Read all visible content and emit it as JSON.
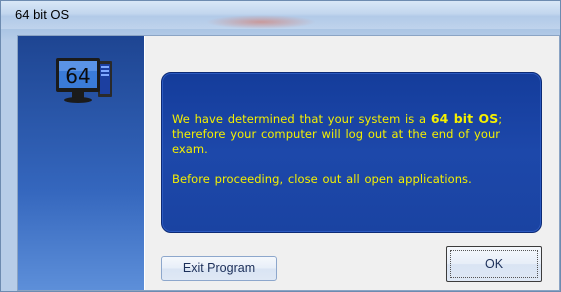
{
  "window": {
    "title": "64 bit OS"
  },
  "sidebar": {
    "icon": "computer-64-icon",
    "icon_label": "64"
  },
  "message": {
    "line1_prefix": "We have determined that your system is a ",
    "line1_emphasis": "64 bit OS",
    "line1_suffix": "; therefore your computer will log out at the end of your exam.",
    "line2": "Before proceeding, close out all open applications."
  },
  "buttons": {
    "exit_label": "Exit Program",
    "ok_label": "OK"
  },
  "colors": {
    "sidebar_blue": "#1e4592",
    "panel_blue": "#1a43a2",
    "message_text": "#f4f000"
  }
}
